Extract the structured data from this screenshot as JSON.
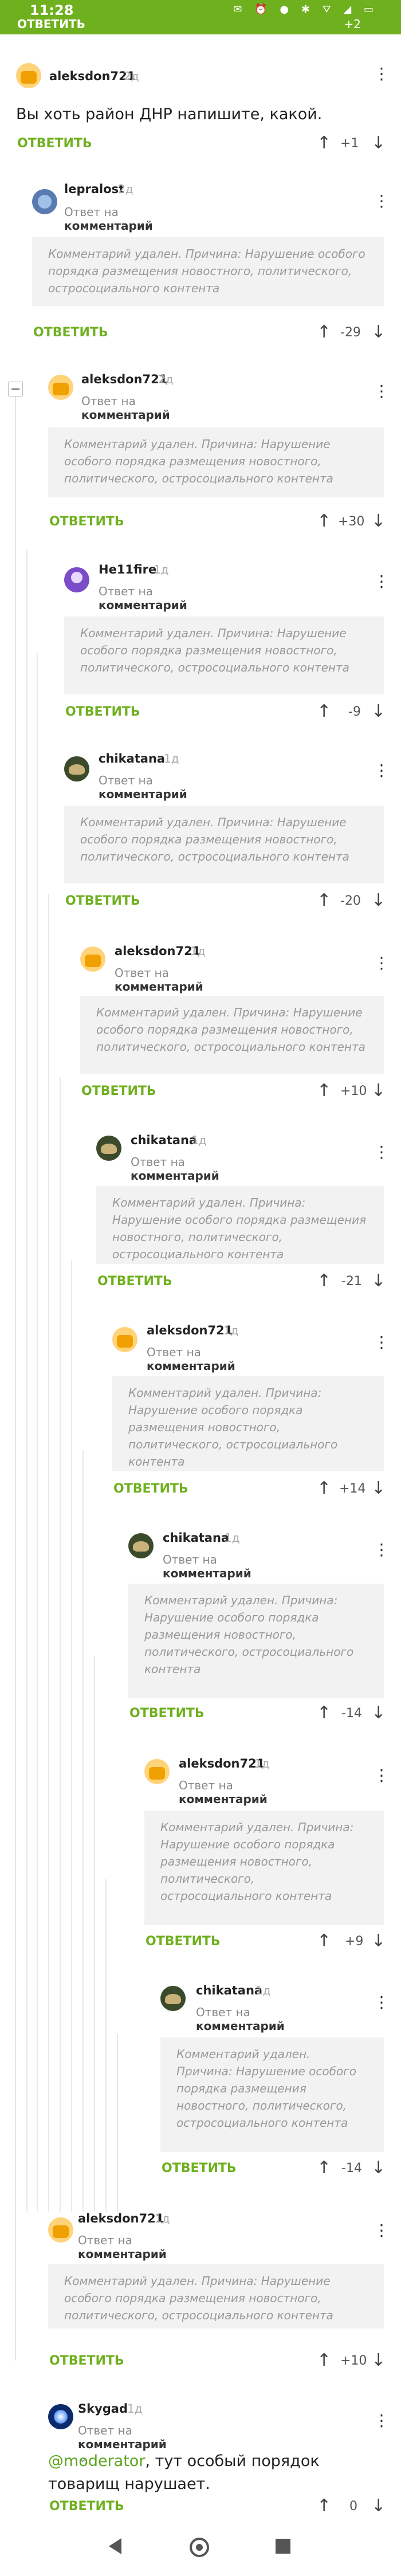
{
  "status_bar": {
    "time": "11:28",
    "icons_text": "✉ ⏰ ●  ✱ ⛛ ◢ ▭"
  },
  "top_partial": {
    "reply_label": "ОТВЕТИТЬ",
    "score": "+2"
  },
  "labels": {
    "reply": "ОТВЕТИТЬ",
    "reply_to_prefix": "Ответ на",
    "reply_to_target": "комментарий",
    "deleted_text": "Комментарий удален. Причина: Нарушение особого порядка размещения новостного, политического, остросоциального контента"
  },
  "comments": [
    {
      "user": "aleksdon721",
      "ago": "2д",
      "text": "Вы хоть район ДНР напишите, какой.",
      "score": "+1"
    },
    {
      "user": "lepralost",
      "ago": "2д",
      "score": "-29"
    },
    {
      "user": "aleksdon721",
      "ago": "2д",
      "score": "+30"
    },
    {
      "user": "He11fire",
      "ago": "1д",
      "score": "-9"
    },
    {
      "user": "chikatana",
      "ago": "1д",
      "score": "-20"
    },
    {
      "user": "aleksdon721",
      "ago": "1д",
      "score": "+10"
    },
    {
      "user": "chikatana",
      "ago": "1д",
      "score": "-21"
    },
    {
      "user": "aleksdon721",
      "ago": "1д",
      "score": "+14"
    },
    {
      "user": "chikatana",
      "ago": "1д",
      "score": "-14"
    },
    {
      "user": "aleksdon721",
      "ago": "1д",
      "score": "+9"
    },
    {
      "user": "chikatana",
      "ago": "1д",
      "score": "-14"
    },
    {
      "user": "aleksdon721",
      "ago": "1д",
      "score": "+10"
    },
    {
      "user": "Skygad",
      "ago": "1д",
      "mention": "@moderator",
      "text": ", тут особый порядок товарищ нарушает.",
      "score": "0"
    }
  ]
}
